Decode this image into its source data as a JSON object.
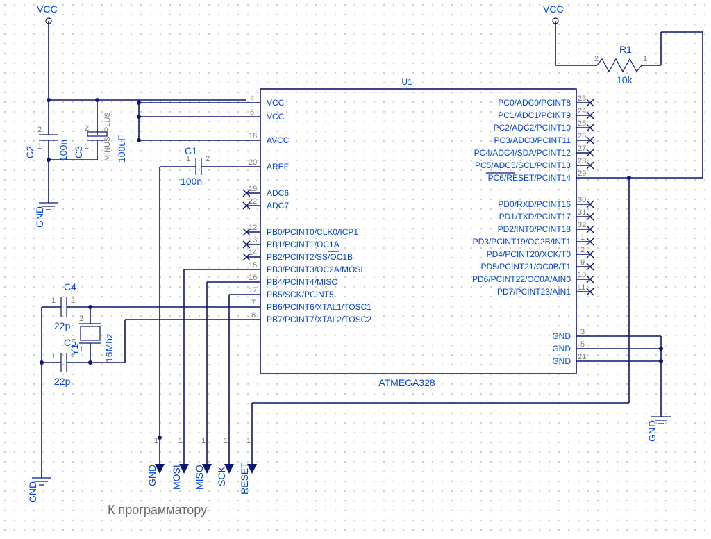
{
  "u1": {
    "ref": "U1",
    "part": "ATMEGA328",
    "left_pins": [
      {
        "num": "4",
        "name": "VCC"
      },
      {
        "num": "6",
        "name": "VCC"
      },
      {
        "num": "",
        "name": ""
      },
      {
        "num": "18",
        "name": "AVCC"
      },
      {
        "num": "",
        "name": ""
      },
      {
        "num": "20",
        "name": "AREF"
      },
      {
        "num": "",
        "name": ""
      },
      {
        "num": "19",
        "name": "ADC6"
      },
      {
        "num": "22",
        "name": "ADC7"
      },
      {
        "num": "",
        "name": ""
      },
      {
        "num": "12",
        "name": "PB0/PCINT0/CLK0/ICP1"
      },
      {
        "num": "13",
        "name": "PB1/PCINT1/OC1A"
      },
      {
        "num": "14",
        "name": "PB2/PCINT2/SS/OC1B"
      },
      {
        "num": "15",
        "name": "PB3/PCINT3/OC2A/MOSI"
      },
      {
        "num": "16",
        "name": "PB4/PCINT4/MISO"
      },
      {
        "num": "17",
        "name": "PB5/SCK/PCINT5"
      },
      {
        "num": "7",
        "name": "PB6/PCINT6/XTAL1/TOSC1"
      },
      {
        "num": "8",
        "name": "PB7/PCINT7/XTAL2/TOSC2"
      }
    ],
    "right_pins": [
      {
        "num": "23",
        "name": "PC0/ADC0/PCINT8"
      },
      {
        "num": "24",
        "name": "PC1/ADC1/PCINT9"
      },
      {
        "num": "25",
        "name": "PC2/ADC2/PCINT10"
      },
      {
        "num": "26",
        "name": "PC3/ADC3/PCINT11"
      },
      {
        "num": "27",
        "name": "PC4/ADC4/SDA/PCINT12"
      },
      {
        "num": "28",
        "name": "PC5/ADC5/SCL/PCINT13"
      },
      {
        "num": "29",
        "name": "PC6/RESET/PCINT14"
      },
      {
        "num": "",
        "name": ""
      },
      {
        "num": "30",
        "name": "PD0/RXD/PCINT16"
      },
      {
        "num": "31",
        "name": "PD1/TXD/PCINT17"
      },
      {
        "num": "32",
        "name": "PD2/INT0/PCINT18"
      },
      {
        "num": "1",
        "name": "PD3/PCINT19/OC2B/INT1"
      },
      {
        "num": "2",
        "name": "PD4/PCINT20/XCK/T0"
      },
      {
        "num": "9",
        "name": "PD5/PCINT21/OC0B/T1"
      },
      {
        "num": "10",
        "name": "PD6/PCINT22/OC0A/AIN0"
      },
      {
        "num": "11",
        "name": "PD7/PCINT23/AIN1"
      }
    ],
    "gnd_pins": [
      {
        "num": "3",
        "name": "GND"
      },
      {
        "num": "5",
        "name": "GND"
      },
      {
        "num": "21",
        "name": "GND"
      }
    ]
  },
  "power": {
    "vcc_left": "VCC",
    "vcc_right": "VCC"
  },
  "gnd_labels": {
    "g1": "GND",
    "g2": "GND",
    "g3": "GND",
    "g4": "GND"
  },
  "components": {
    "c1": {
      "ref": "C1",
      "val": "100n",
      "pin1": "1",
      "pin2": "2"
    },
    "c2": {
      "ref": "C2",
      "val": "100n",
      "pin1": "1",
      "pin2": "2"
    },
    "c3": {
      "ref": "C3",
      "val": "100uF",
      "pin1": "1",
      "pin2": "2",
      "pluslabel": "PLUS",
      "minuslabel": "MINUS"
    },
    "c4": {
      "ref": "C4",
      "val": "22p",
      "pin1": "1",
      "pin2": "2"
    },
    "c5": {
      "ref": "C5",
      "val": "22p",
      "pin1": "1",
      "pin2": "2"
    },
    "r1": {
      "ref": "R1",
      "val": "10k",
      "pin1": "1",
      "pin2": "2"
    },
    "y1": {
      "ref": "Y1",
      "val": "16Mhz",
      "pin1": "1",
      "pin2": "2"
    }
  },
  "arrows": {
    "gnd": "GND",
    "mosi": "MOSI",
    "miso": "MISO",
    "sck": "SCK",
    "reset": "RESET"
  },
  "caption": "К программатору"
}
